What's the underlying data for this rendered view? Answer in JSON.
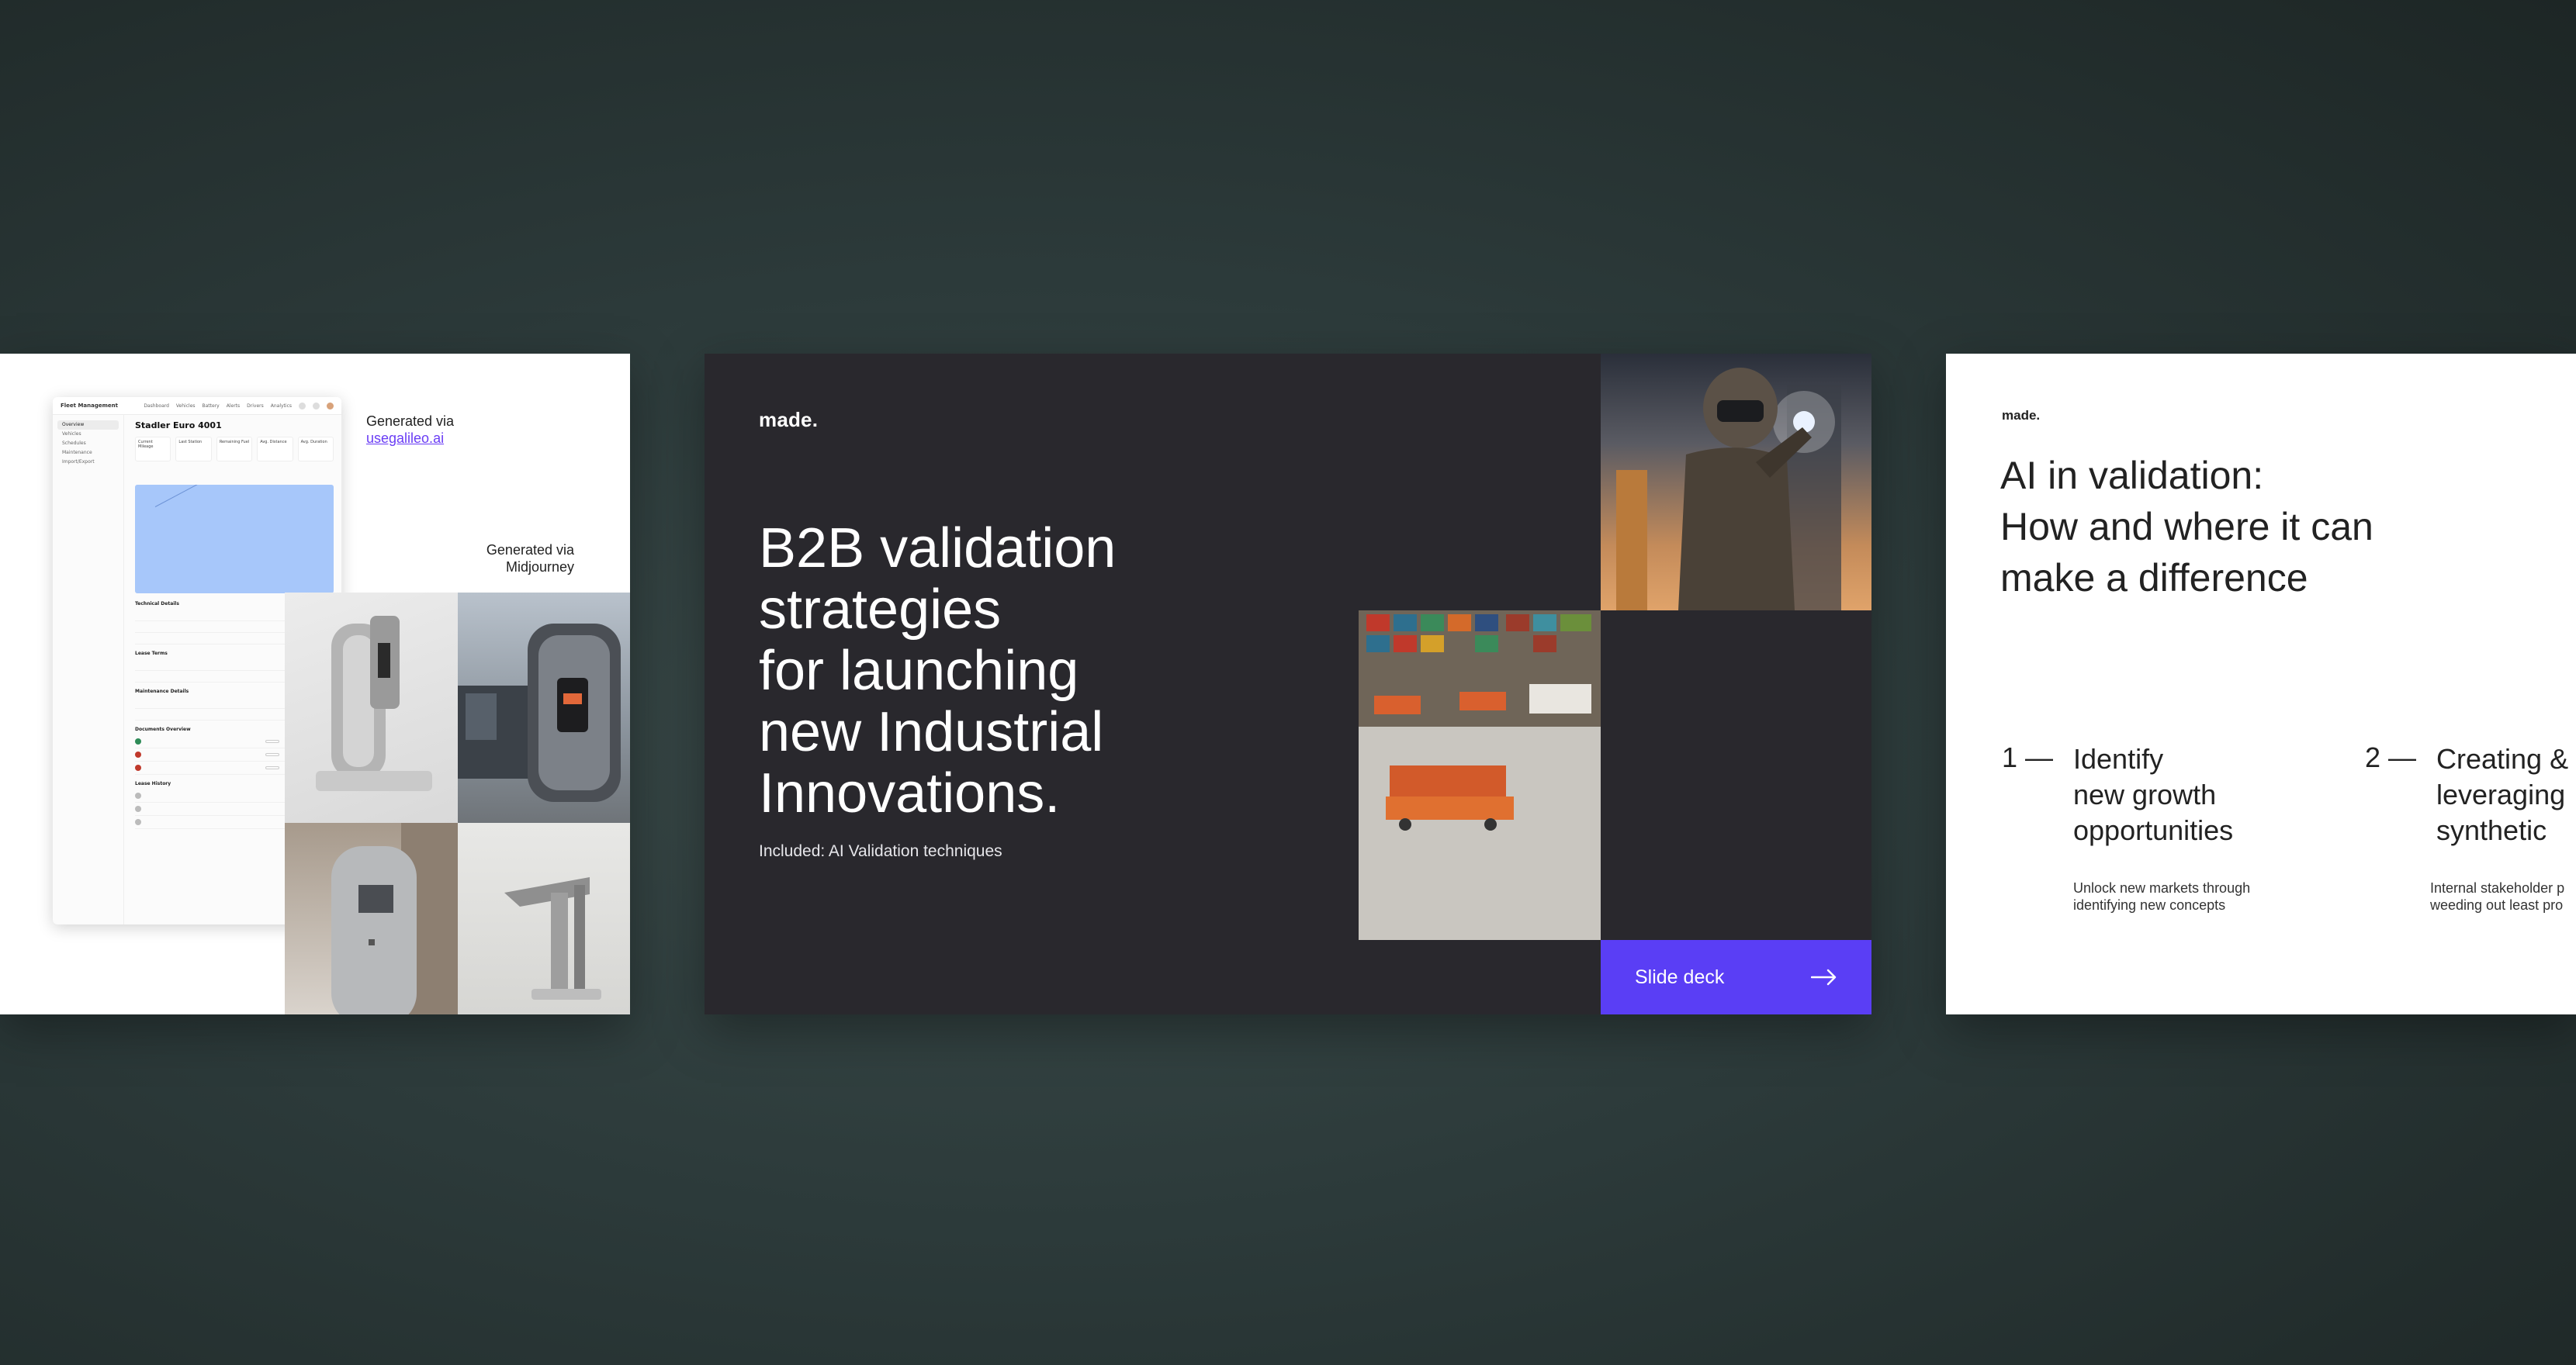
{
  "left_slide": {
    "mock_app": {
      "brand": "Fleet Management",
      "nav": [
        "Dashboard",
        "Vehicles",
        "Battery",
        "Alerts",
        "Drivers",
        "Analytics"
      ],
      "sidebar": [
        "Overview",
        "Vehicles",
        "Schedules",
        "Maintenance",
        "Import/Export"
      ],
      "vehicle_title": "Stadler Euro 4001",
      "stats": [
        "Current Mileage",
        "Last Station",
        "Remaining Fuel",
        "Avg. Distance",
        "Avg. Duration"
      ],
      "sections": [
        "Technical Details",
        "Lease Terms",
        "Maintenance Details",
        "Documents Overview",
        "Lease History"
      ]
    },
    "generated_1_prefix": "Generated via",
    "generated_1_link": "usegalileo.ai",
    "generated_2": "Generated via\nMidjourney"
  },
  "center_slide": {
    "logo": "made.",
    "title": "B2B validation\nstrategies\nfor launching\nnew Industrial\nInnovations.",
    "subtitle": "Included: AI Validation techniques",
    "cta_label": "Slide deck",
    "cta_icon": "arrow-right-icon"
  },
  "right_slide": {
    "logo": "made.",
    "title": "AI in validation:\nHow and where it can\nmake a difference",
    "items": [
      {
        "number": "1 —",
        "heading": "Identify\nnew growth\nopportunities",
        "description": "Unlock new markets through\nidentifying new concepts"
      },
      {
        "number": "2 —",
        "heading": "Creating &\nleveraging\nsynthetic",
        "description": "Internal stakeholder p\nweeding out least pro"
      }
    ]
  },
  "colors": {
    "background": "#2c3a3a",
    "center_slide_bg": "#29282d",
    "accent": "#5a3ef5",
    "link": "#6a3df5"
  }
}
